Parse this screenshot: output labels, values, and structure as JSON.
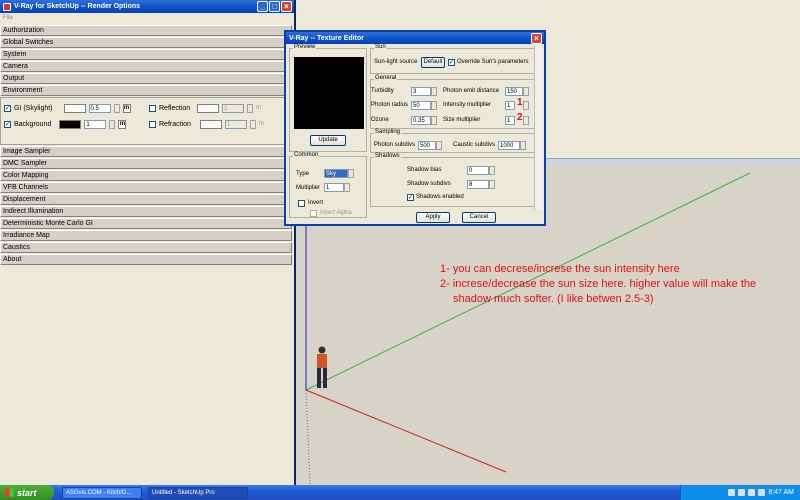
{
  "vray_window": {
    "title": "V-Ray for SketchUp -- Render Options",
    "menu": "File",
    "rollouts_top": [
      "Authorization",
      "Global Switches",
      "System",
      "Camera",
      "Output",
      "Environment"
    ],
    "environment": {
      "gi_label": "GI (Skylight)",
      "gi_value": "0.5",
      "background_label": "Background",
      "background_value": "1",
      "reflection_label": "Reflection",
      "reflection_value": "1",
      "refraction_label": "Refraction",
      "refraction_value": "1",
      "m_label": "m"
    },
    "rollouts_bottom": [
      "Image Sampler",
      "DMC Sampler",
      "Color Mapping",
      "VFB Channels",
      "Displacement",
      "Indirect Illumination",
      "Deterministic Monte Carlo GI",
      "Irradiance Map",
      "Caustics",
      "About"
    ]
  },
  "texture_editor": {
    "title": "V-Ray -- Texture Editor",
    "preview_label": "Preview",
    "update_button": "Update",
    "common_label": "Common",
    "type_label": "Type",
    "type_value": "Sky",
    "multiplier_label": "Multiplier",
    "multiplier_value": "1",
    "invert_label": "Invert",
    "invert_alpha_label": "Invert Alpha",
    "sun_label": "Sun",
    "sunlight_source_label": "Sun-light source",
    "default_button": "Default",
    "override_label": "Override Sun's parameters",
    "general_label": "General",
    "turbidity_label": "Turbidity",
    "turbidity_value": "3",
    "photon_emit_label": "Photon emit distance",
    "photon_emit_value": "150",
    "photon_radius_label": "Photon radius",
    "photon_radius_value": "50",
    "intensity_label": "Intensity multiplier",
    "intensity_value": "1",
    "ozone_label": "Ozone",
    "ozone_value": "0.35",
    "size_label": "Size multiplier",
    "size_value": "1",
    "sampling_label": "Sampling",
    "photon_subdivs_label": "Photon subdivs",
    "photon_subdivs_value": "500",
    "caustic_subdivs_label": "Caustic subdivs",
    "caustic_subdivs_value": "1000",
    "shadows_label": "Shadows",
    "shadow_bias_label": "Shadow bias",
    "shadow_bias_value": "0",
    "shadow_subdivs_label": "Shadow subdivs",
    "shadow_subdivs_value": "8",
    "shadows_enabled_label": "Shadows enabled",
    "apply_button": "Apply",
    "cancel_button": "Cancel",
    "marker1": "1",
    "marker2": "2"
  },
  "annotation": {
    "line1": "1- you can decrese/increse the sun intensity here",
    "line2": "2- increse/decrease the sun size here.  higher value will make the",
    "line3": "shadow much softer. (I like betwen 2.5-3)"
  },
  "taskbar": {
    "start": "start",
    "tasks": [
      "ASGvis.COM - Kitch/D...",
      "Untitled - SketchUp Pro"
    ],
    "clock": "8:47 AM"
  },
  "colors": {
    "annotation_red": "#e01010",
    "axis_green": "#3cb043",
    "axis_red": "#d02020",
    "axis_blue": "#2020c0"
  }
}
